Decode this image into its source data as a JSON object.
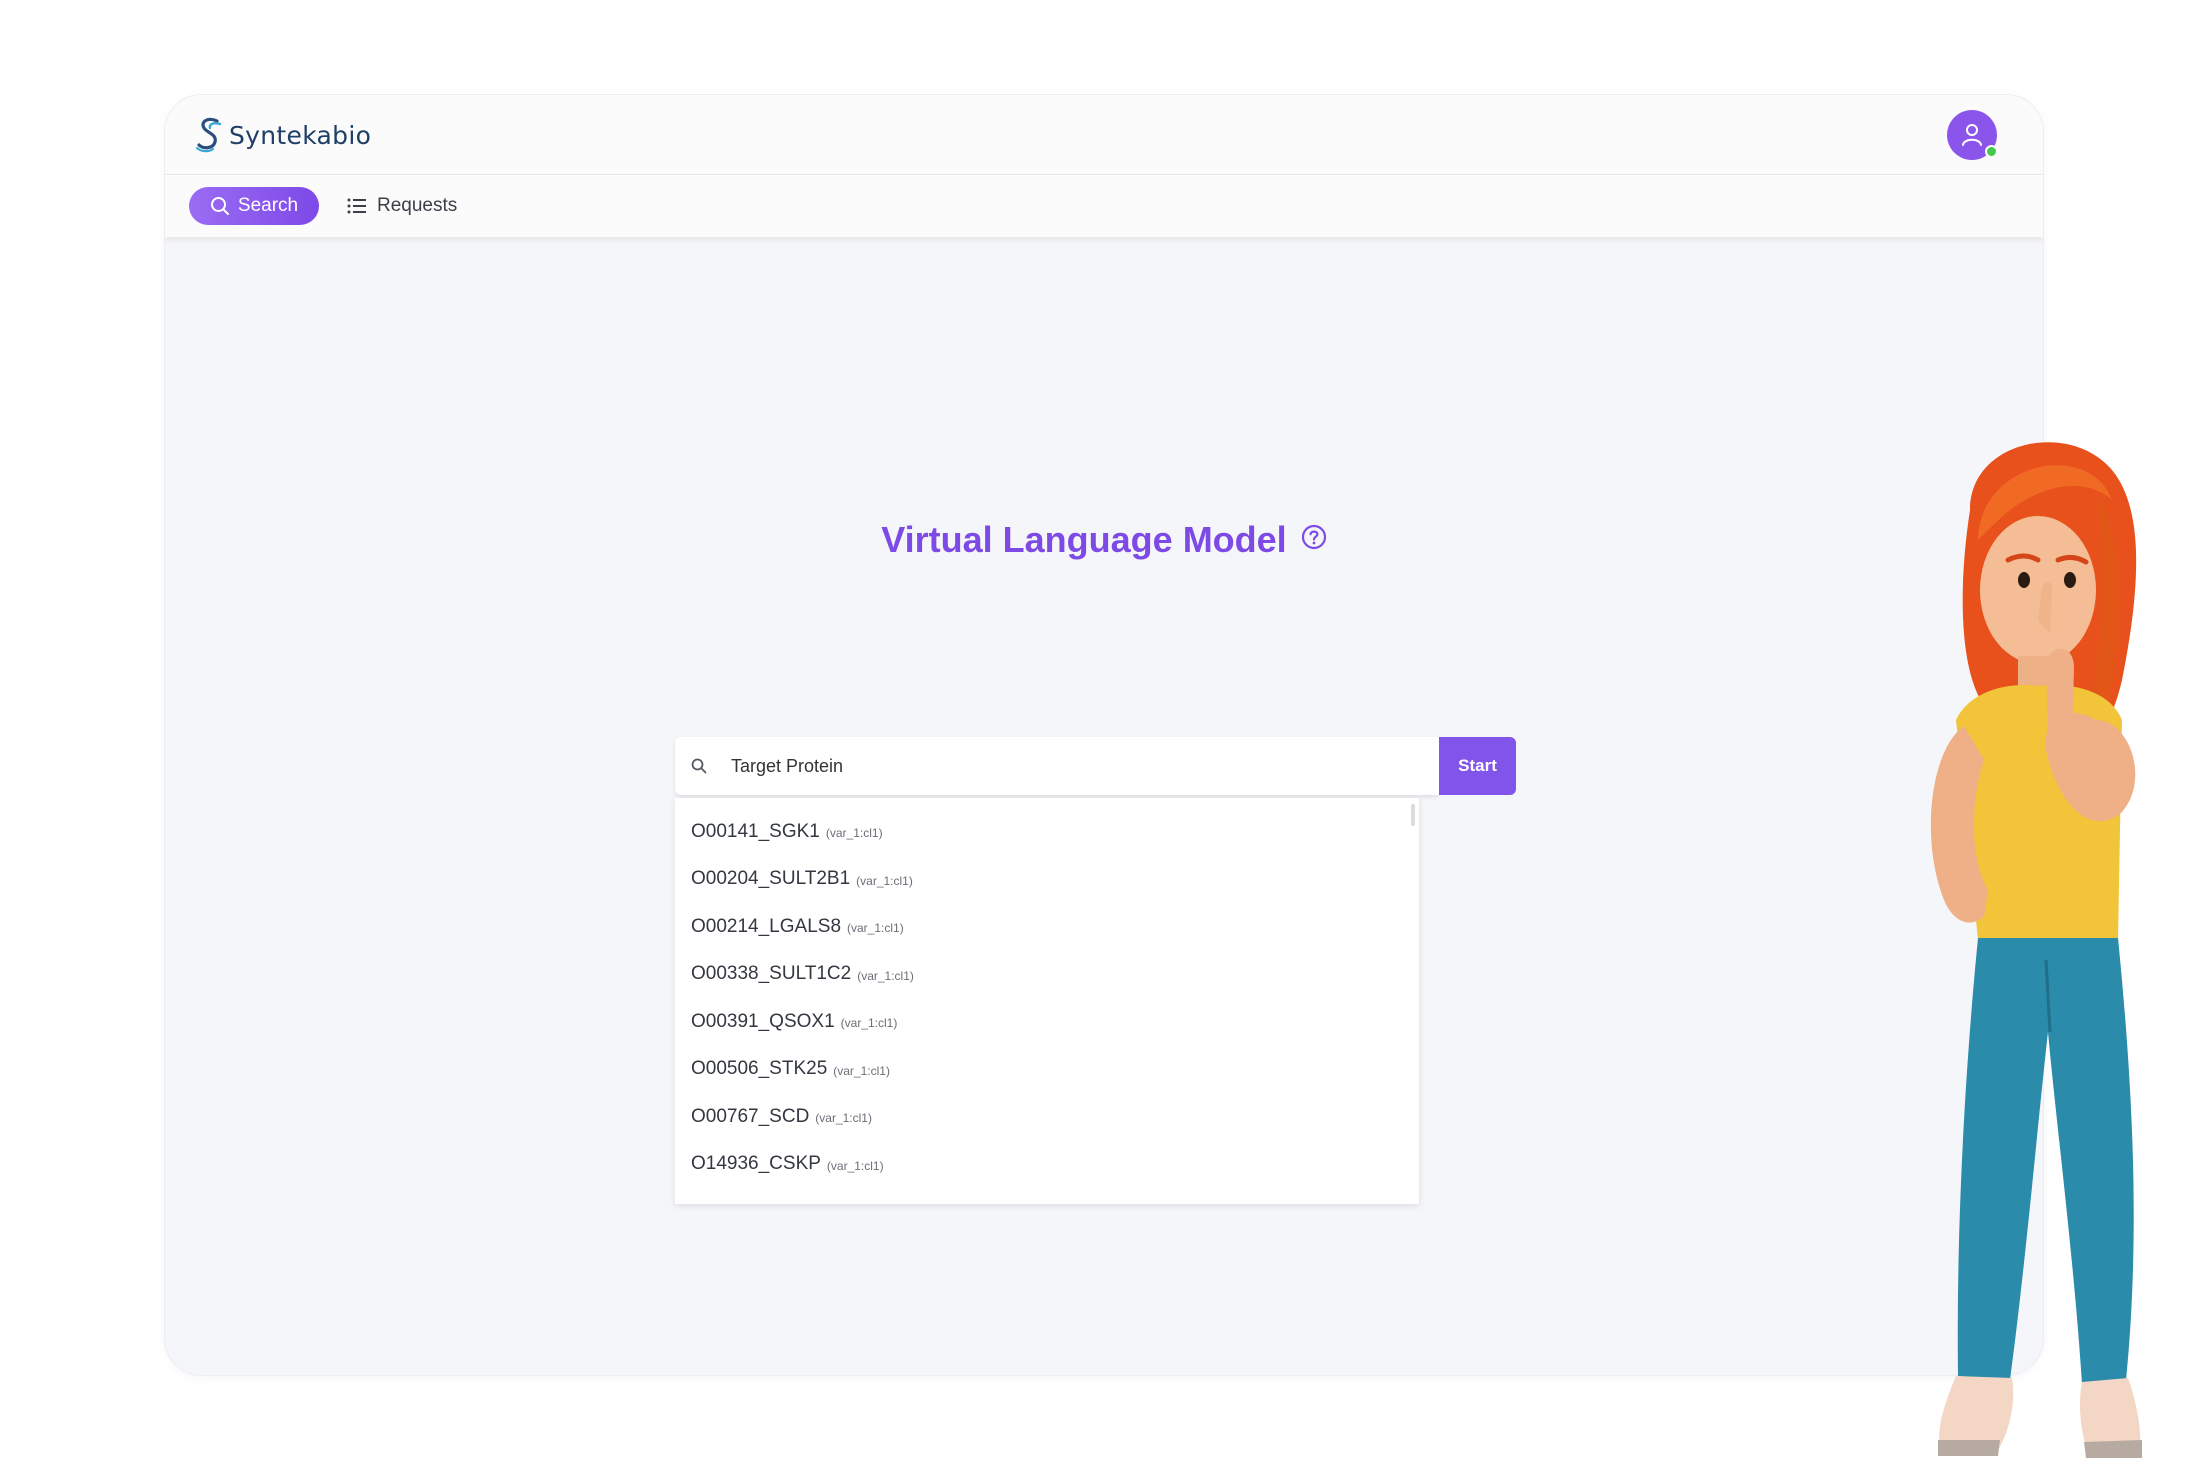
{
  "app": {
    "logo_text": "Syntekabio"
  },
  "nav": {
    "search_label": "Search",
    "requests_label": "Requests"
  },
  "main": {
    "title": "Virtual Language Model"
  },
  "search": {
    "input_value": "Target Protein",
    "start_label": "Start"
  },
  "dropdown": {
    "items": [
      {
        "code": "O00141_SGK1",
        "variant": "(var_1:cl1)"
      },
      {
        "code": "O00204_SULT2B1",
        "variant": "(var_1:cl1)"
      },
      {
        "code": "O00214_LGALS8",
        "variant": "(var_1:cl1)"
      },
      {
        "code": "O00338_SULT1C2",
        "variant": "(var_1:cl1)"
      },
      {
        "code": "O00391_QSOX1",
        "variant": "(var_1:cl1)"
      },
      {
        "code": "O00506_STK25",
        "variant": "(var_1:cl1)"
      },
      {
        "code": "O00767_SCD",
        "variant": "(var_1:cl1)"
      },
      {
        "code": "O14936_CSKP",
        "variant": "(var_1:cl1)"
      }
    ]
  },
  "colors": {
    "accent": "#8154ea",
    "title": "#7e4ae6",
    "status_online": "#44c84d"
  },
  "icons": {
    "logo": "syntekabio-s-logo-icon",
    "avatar": "user-icon",
    "search": "search-icon",
    "requests": "list-icon",
    "help": "question-circle-icon"
  }
}
